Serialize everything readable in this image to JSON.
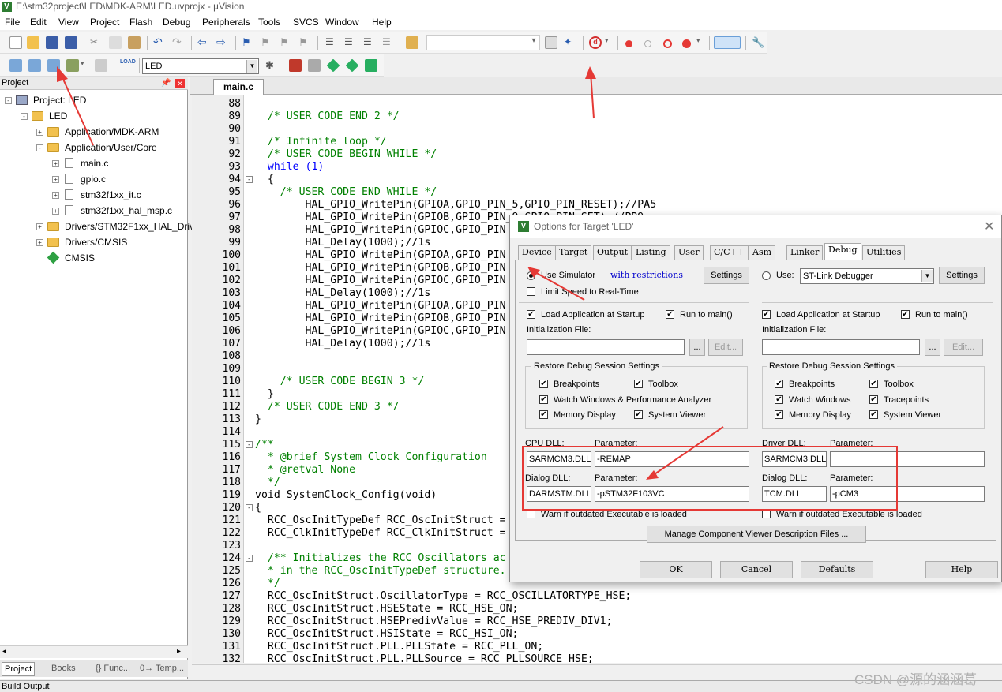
{
  "window": {
    "title": "E:\\stm32project\\LED\\MDK-ARM\\LED.uvprojx - µVision"
  },
  "menu": [
    "File",
    "Edit",
    "View",
    "Project",
    "Flash",
    "Debug",
    "Peripherals",
    "Tools",
    "SVCS",
    "Window",
    "Help"
  ],
  "toolbar2": {
    "target_name": "LED"
  },
  "project_panel": {
    "title": "Project",
    "tree": [
      {
        "label": "Project: LED",
        "level": 0,
        "icon": "project-icon",
        "expander": "-"
      },
      {
        "label": "LED",
        "level": 1,
        "icon": "target-folder-icon",
        "expander": "-"
      },
      {
        "label": "Application/MDK-ARM",
        "level": 2,
        "icon": "folder-icon",
        "expander": "+"
      },
      {
        "label": "Application/User/Core",
        "level": 2,
        "icon": "folder-icon",
        "expander": "-"
      },
      {
        "label": "main.c",
        "level": 3,
        "icon": "file-icon",
        "expander": "+"
      },
      {
        "label": "gpio.c",
        "level": 3,
        "icon": "file-icon",
        "expander": "+"
      },
      {
        "label": "stm32f1xx_it.c",
        "level": 3,
        "icon": "file-icon",
        "expander": "+"
      },
      {
        "label": "stm32f1xx_hal_msp.c",
        "level": 3,
        "icon": "file-icon",
        "expander": "+"
      },
      {
        "label": "Drivers/STM32F1xx_HAL_Driv",
        "level": 2,
        "icon": "folder-icon",
        "expander": "+"
      },
      {
        "label": "Drivers/CMSIS",
        "level": 2,
        "icon": "folder-icon",
        "expander": "+"
      },
      {
        "label": "CMSIS",
        "level": 2,
        "icon": "cmsis-diamond-icon",
        "expander": ""
      }
    ],
    "tabs": [
      "Project",
      "Books",
      "{} Func...",
      "0→ Temp..."
    ]
  },
  "build_output": {
    "label": "Build Output"
  },
  "editor": {
    "tab": "main.c",
    "lines": [
      {
        "n": "88",
        "t": ""
      },
      {
        "n": "89",
        "t": "  /* USER CODE END 2 */",
        "c": "cm"
      },
      {
        "n": "90",
        "t": ""
      },
      {
        "n": "91",
        "t": "  /* Infinite loop */",
        "c": "cm"
      },
      {
        "n": "92",
        "t": "  /* USER CODE BEGIN WHILE */",
        "c": "cm"
      },
      {
        "n": "93",
        "t": "  while (1)",
        "c": "kw"
      },
      {
        "n": "94",
        "t": "  {",
        "f": "-"
      },
      {
        "n": "95",
        "t": "    /* USER CODE END WHILE */",
        "c": "cm"
      },
      {
        "n": "96",
        "t": "        HAL_GPIO_WritePin(GPIOA,GPIO_PIN_5,GPIO_PIN_RESET);//PA5"
      },
      {
        "n": "97",
        "t": "        HAL_GPIO_WritePin(GPIOB,GPIO_PIN_9,GPIO_PIN_SET);//PB9"
      },
      {
        "n": "98",
        "t": "        HAL_GPIO_WritePin(GPIOC,GPIO_PIN"
      },
      {
        "n": "99",
        "t": "        HAL_Delay(1000);//1s"
      },
      {
        "n": "100",
        "t": "        HAL_GPIO_WritePin(GPIOA,GPIO_PIN"
      },
      {
        "n": "101",
        "t": "        HAL_GPIO_WritePin(GPIOB,GPIO_PIN"
      },
      {
        "n": "102",
        "t": "        HAL_GPIO_WritePin(GPIOC,GPIO_PIN"
      },
      {
        "n": "103",
        "t": "        HAL_Delay(1000);//1s"
      },
      {
        "n": "104",
        "t": "        HAL_GPIO_WritePin(GPIOA,GPIO_PIN"
      },
      {
        "n": "105",
        "t": "        HAL_GPIO_WritePin(GPIOB,GPIO_PIN"
      },
      {
        "n": "106",
        "t": "        HAL_GPIO_WritePin(GPIOC,GPIO_PIN"
      },
      {
        "n": "107",
        "t": "        HAL_Delay(1000);//1s"
      },
      {
        "n": "108",
        "t": ""
      },
      {
        "n": "109",
        "t": ""
      },
      {
        "n": "110",
        "t": "    /* USER CODE BEGIN 3 */",
        "c": "cm"
      },
      {
        "n": "111",
        "t": "  }"
      },
      {
        "n": "112",
        "t": "  /* USER CODE END 3 */",
        "c": "cm"
      },
      {
        "n": "113",
        "t": "}"
      },
      {
        "n": "114",
        "t": ""
      },
      {
        "n": "115",
        "t": "/**",
        "c": "cm",
        "f": "-"
      },
      {
        "n": "116",
        "t": "  * @brief System Clock Configuration",
        "c": "cm"
      },
      {
        "n": "117",
        "t": "  * @retval None",
        "c": "cm"
      },
      {
        "n": "118",
        "t": "  */",
        "c": "cm"
      },
      {
        "n": "119",
        "t": "void SystemClock_Config(void)",
        "c": "kwfn"
      },
      {
        "n": "120",
        "t": "{",
        "f": "-"
      },
      {
        "n": "121",
        "t": "  RCC_OscInitTypeDef RCC_OscInitStruct ="
      },
      {
        "n": "122",
        "t": "  RCC_ClkInitTypeDef RCC_ClkInitStruct ="
      },
      {
        "n": "123",
        "t": ""
      },
      {
        "n": "124",
        "t": "  /** Initializes the RCC Oscillators ac",
        "c": "cm",
        "f": "-"
      },
      {
        "n": "125",
        "t": "  * in the RCC_OscInitTypeDef structure.",
        "c": "cm"
      },
      {
        "n": "126",
        "t": "  */",
        "c": "cm"
      },
      {
        "n": "127",
        "t": "  RCC_OscInitStruct.OscillatorType = RCC_OSCILLATORTYPE_HSE;"
      },
      {
        "n": "128",
        "t": "  RCC_OscInitStruct.HSEState = RCC_HSE_ON;"
      },
      {
        "n": "129",
        "t": "  RCC_OscInitStruct.HSEPredivValue = RCC_HSE_PREDIV_DIV1;"
      },
      {
        "n": "130",
        "t": "  RCC_OscInitStruct.HSIState = RCC_HSI_ON;"
      },
      {
        "n": "131",
        "t": "  RCC_OscInitStruct.PLL.PLLState = RCC_PLL_ON;"
      },
      {
        "n": "132",
        "t": "  RCC_OscInitStruct.PLL.PLLSource = RCC_PLLSOURCE_HSE;"
      }
    ]
  },
  "dialog": {
    "title": "Options for Target 'LED'",
    "tabs": [
      "Device",
      "Target",
      "Output",
      "Listing",
      "User",
      "C/C++",
      "Asm",
      "Linker",
      "Debug",
      "Utilities"
    ],
    "active_tab": "Debug",
    "left": {
      "use_simulator": "Use Simulator",
      "with_restrictions": "with restrictions",
      "settings": "Settings",
      "limit_speed": "Limit Speed to Real-Time",
      "load_app": "Load Application at Startup",
      "run_to_main": "Run to main()",
      "init_file_label": "Initialization File:",
      "browse": "...",
      "edit": "Edit...",
      "restore_title": "Restore Debug Session Settings",
      "breakpoints": "Breakpoints",
      "toolbox": "Toolbox",
      "watch_windows": "Watch Windows & Performance Analyzer",
      "memory_display": "Memory Display",
      "system_viewer": "System Viewer",
      "cpu_dll_label": "CPU DLL:",
      "parameter_label": "Parameter:",
      "cpu_dll": "SARMCM3.DLL",
      "cpu_param": "-REMAP",
      "dialog_dll_label": "Dialog DLL:",
      "dialog_dll": "DARMSTM.DLL",
      "dialog_param": "-pSTM32F103VC",
      "warn": "Warn if outdated Executable is loaded"
    },
    "right": {
      "use": "Use:",
      "debugger": "ST-Link Debugger",
      "settings": "Settings",
      "load_app": "Load Application at Startup",
      "run_to_main": "Run to main()",
      "init_file_label": "Initialization File:",
      "browse": "...",
      "edit": "Edit...",
      "restore_title": "Restore Debug Session Settings",
      "breakpoints": "Breakpoints",
      "toolbox": "Toolbox",
      "watch_windows": "Watch Windows",
      "tracepoints": "Tracepoints",
      "memory_display": "Memory Display",
      "system_viewer": "System Viewer",
      "driver_dll_label": "Driver DLL:",
      "parameter_label": "Parameter:",
      "driver_dll": "SARMCM3.DLL",
      "driver_param": "",
      "dialog_dll_label": "Dialog DLL:",
      "dialog_dll": "TCM.DLL",
      "dialog_param": "-pCM3",
      "warn": "Warn if outdated Executable is loaded"
    },
    "manage_btn": "Manage Component Viewer Description Files ...",
    "ok": "OK",
    "cancel": "Cancel",
    "defaults": "Defaults",
    "help": "Help"
  },
  "watermark": "CSDN @源的涵涵葛",
  "colors": {
    "annotation_red": "#e53935",
    "comment_green": "#008000",
    "keyword_blue": "#0000ff"
  }
}
